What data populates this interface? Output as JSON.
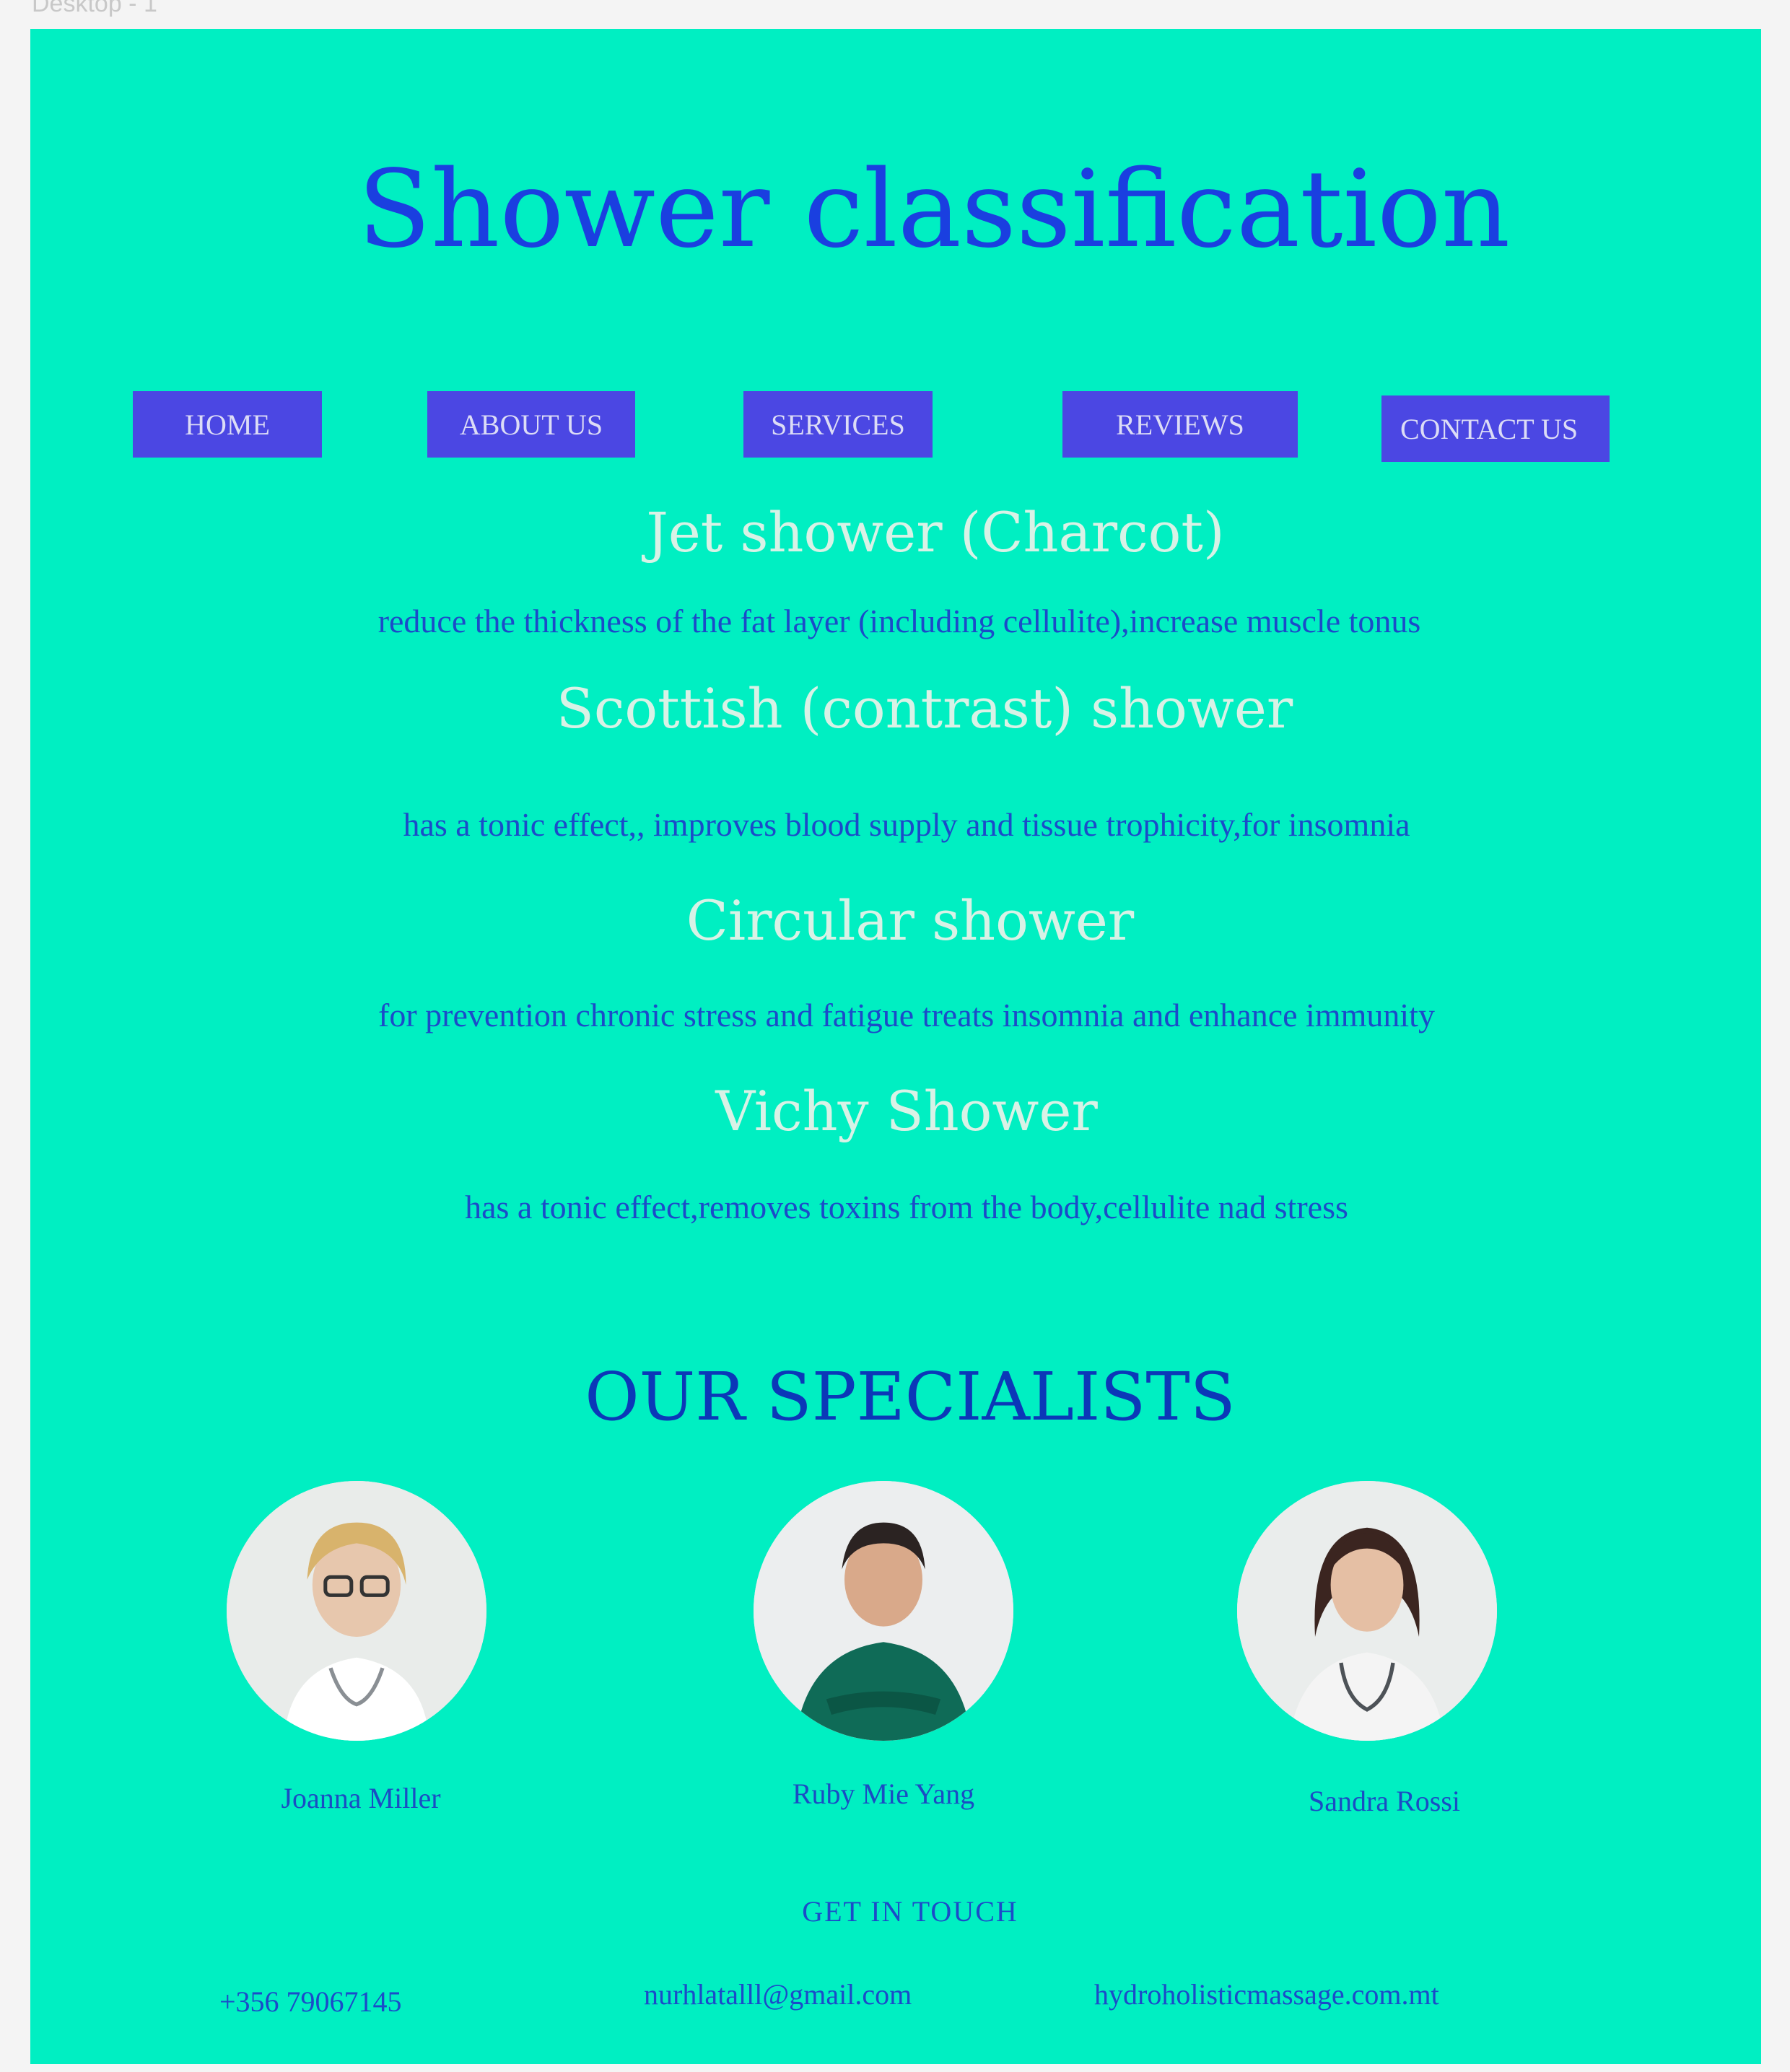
{
  "frame_label": "Desktop - 1",
  "page_title": "Shower classification",
  "nav": [
    {
      "label": "HOME"
    },
    {
      "label": "ABOUT US"
    },
    {
      "label": "SERVICES"
    },
    {
      "label": "REVIEWS"
    },
    {
      "label": "CONTACT US"
    }
  ],
  "sections": [
    {
      "heading": "Jet shower  (Charcot)",
      "text": "reduce the thickness of the fat layer (including cellulite),increase muscle tonus"
    },
    {
      "heading": "Scottish (contrast) shower",
      "text": "has a tonic effect,, improves blood supply and tissue trophicity,for insomnia"
    },
    {
      "heading": "Circular shower",
      "text": "for prevention chronic stress and fatigue treats insomnia and enhance immunity"
    },
    {
      "heading": "Vichy Shower",
      "text": "has a tonic effect,removes toxins from the body,cellulite nad stress"
    }
  ],
  "specialists_heading": "OUR SPECIALISTS",
  "specialists": [
    {
      "name": "Joanna Miller"
    },
    {
      "name": "Ruby Mie Yang"
    },
    {
      "name": "Sandra Rossi"
    }
  ],
  "contact": {
    "heading": "GET IN TOUCH",
    "phone": "+356 79067145",
    "email": "nurhlatalll@gmail.com",
    "website": "hydroholisticmassage.com.mt"
  },
  "colors": {
    "background": "#00efc2",
    "title": "#1a3fe0",
    "nav_button": "#4b47e3",
    "section_heading": "#d8f2e6",
    "body_text": "#1b4bc9"
  }
}
